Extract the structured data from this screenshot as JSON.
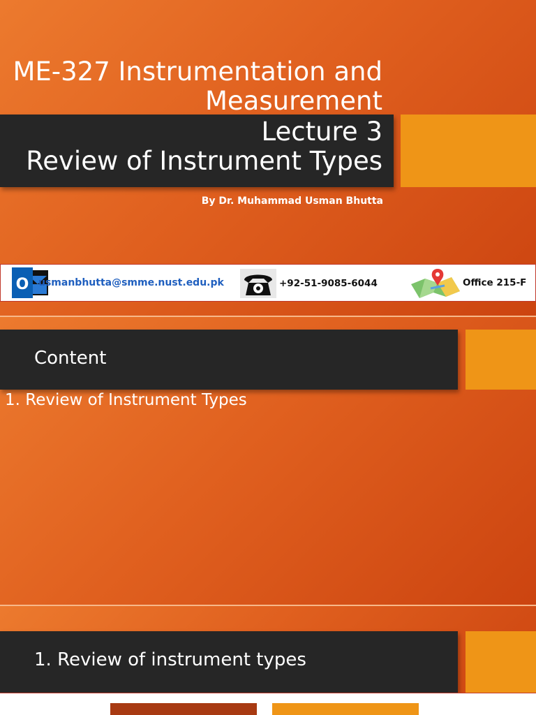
{
  "slide1": {
    "title": "ME-327 Instrumentation and Measurement",
    "lecture": "Lecture 3",
    "subtitle": "Review of Instrument Types",
    "author": "By Dr. Muhammad Usman Bhutta",
    "contact": {
      "outlook_icon_letter": "O",
      "email": "usmanbhutta@smme.nust.edu.pk",
      "phone": "+92-51-9085-6044",
      "office": "Office 215-F",
      "icons": [
        "outlook-icon",
        "telephone-icon",
        "map-pin-icon"
      ]
    }
  },
  "slide2": {
    "heading": "Content",
    "items": [
      "1. Review of Instrument Types"
    ]
  },
  "slide3": {
    "heading": "1. Review of instrument types"
  },
  "colors": {
    "background_orange": "#e0601f",
    "dark_band": "#262626",
    "accent_orange": "#ef9517",
    "email_blue": "#1f5fbf"
  }
}
